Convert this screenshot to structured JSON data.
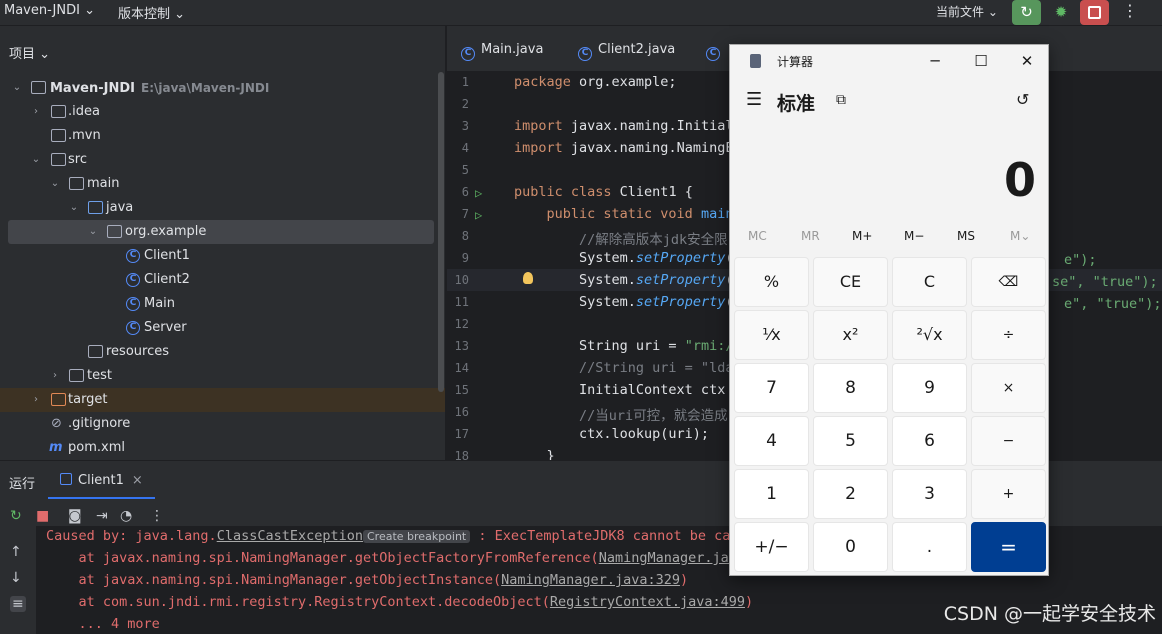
{
  "topbar": {
    "project_name": "Maven-JNDI ⌄",
    "vcs": "版本控制 ⌄",
    "current_file": "当前文件 ⌄"
  },
  "project_panel": {
    "title": "项目 ⌄",
    "root_path": "E:\\java\\Maven-JNDI",
    "items": [
      {
        "label": "Maven-JNDI"
      },
      {
        "label": ".idea"
      },
      {
        "label": ".mvn"
      },
      {
        "label": "src"
      },
      {
        "label": "main"
      },
      {
        "label": "java"
      },
      {
        "label": "org.example"
      },
      {
        "label": "Client1"
      },
      {
        "label": "Client2"
      },
      {
        "label": "Main"
      },
      {
        "label": "Server"
      },
      {
        "label": "resources"
      },
      {
        "label": "test"
      },
      {
        "label": "target"
      },
      {
        "label": ".gitignore"
      },
      {
        "label": "pom.xml"
      }
    ]
  },
  "editor": {
    "tabs": [
      {
        "label": "Main.java"
      },
      {
        "label": "Client2.java"
      }
    ],
    "lines": [
      {
        "n": "1",
        "parts": [
          [
            "kw",
            "package "
          ],
          [
            "",
            "org.example;"
          ]
        ]
      },
      {
        "n": "2",
        "parts": []
      },
      {
        "n": "3",
        "parts": [
          [
            "kw",
            "import "
          ],
          [
            "",
            "javax.naming.Initial"
          ]
        ]
      },
      {
        "n": "4",
        "parts": [
          [
            "kw",
            "import "
          ],
          [
            "",
            "javax.naming.NamingE"
          ]
        ]
      },
      {
        "n": "5",
        "parts": []
      },
      {
        "n": "6",
        "parts": [
          [
            "kw",
            "public class "
          ],
          [
            "",
            "Client1 {"
          ]
        ]
      },
      {
        "n": "7",
        "parts": [
          [
            "kw",
            "    public static void "
          ],
          [
            "fn",
            "main"
          ]
        ]
      },
      {
        "n": "8",
        "parts": [
          [
            "cm",
            "        //解除高版本jdk安全限"
          ]
        ]
      },
      {
        "n": "9",
        "parts": [
          [
            "",
            "        System."
          ],
          [
            "it",
            "setProperty"
          ],
          [
            "",
            "("
          ]
        ]
      },
      {
        "n": "10",
        "parts": [
          [
            "",
            "        System."
          ],
          [
            "it",
            "setProperty"
          ],
          [
            "",
            "("
          ]
        ]
      },
      {
        "n": "11",
        "parts": [
          [
            "",
            "        System."
          ],
          [
            "it",
            "setProperty"
          ],
          [
            "",
            "("
          ]
        ]
      },
      {
        "n": "12",
        "parts": []
      },
      {
        "n": "13",
        "parts": [
          [
            "",
            "        String uri = "
          ],
          [
            "str",
            "\"rmi:/"
          ]
        ]
      },
      {
        "n": "14",
        "parts": [
          [
            "cm",
            "        //String uri = \"lda"
          ]
        ]
      },
      {
        "n": "15",
        "parts": [
          [
            "",
            "        InitialContext ctx "
          ]
        ]
      },
      {
        "n": "16",
        "parts": [
          [
            "cm",
            "        //当uri可控，就会造成"
          ]
        ]
      },
      {
        "n": "17",
        "parts": [
          [
            "",
            "        ctx.lookup(uri);"
          ]
        ]
      },
      {
        "n": "18",
        "parts": [
          [
            "",
            "    }"
          ]
        ]
      }
    ],
    "overflow": {
      "l9": "e\");",
      "l10": "se\", \"true\");",
      "l11": "e\", \"true\");"
    }
  },
  "run_panel": {
    "title": "运行",
    "tab": "Client1",
    "lines": {
      "l1_pre": "Caused by: java.lang.",
      "l1_exc": "ClassCastException",
      "l1_btn": "Create breakpoint",
      "l1_post": " : ExecTemplateJDK8 cannot be ca",
      "l2_pre": "    at javax.naming.spi.NamingManager.getObjectFactoryFromReference(",
      "l2_link": "NamingManager.java",
      "l3_pre": "    at javax.naming.spi.NamingManager.getObjectInstance(",
      "l3_link": "NamingManager.java:329",
      "l3_post": ")",
      "l4_pre": "    at com.sun.jndi.rmi.registry.RegistryContext.decodeObject(",
      "l4_link": "RegistryContext.java:499",
      "l4_post": ")",
      "l5": "    ... 4 more"
    }
  },
  "calculator": {
    "title": "计算器",
    "mode": "标准",
    "display": "0",
    "memory": [
      "MC",
      "MR",
      "M+",
      "M−",
      "MS",
      "M⌄"
    ],
    "keys": [
      [
        "%",
        "CE",
        "C",
        "⌫"
      ],
      [
        "¹⁄x",
        "x²",
        "²√x",
        "÷"
      ],
      [
        "7",
        "8",
        "9",
        "×"
      ],
      [
        "4",
        "5",
        "6",
        "−"
      ],
      [
        "1",
        "2",
        "3",
        "+"
      ],
      [
        "+/−",
        "0",
        ".",
        "="
      ]
    ]
  },
  "watermark": "CSDN @一起学安全技术"
}
